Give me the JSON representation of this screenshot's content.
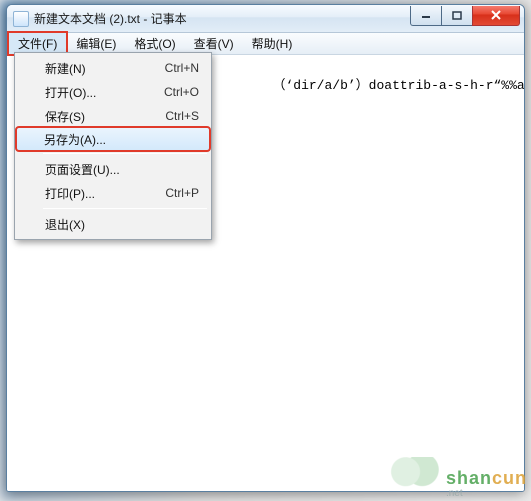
{
  "window": {
    "title": "新建文本文档 (2).txt - 记事本"
  },
  "menubar": {
    "file": "文件(F)",
    "edit": "编辑(E)",
    "format": "格式(O)",
    "view": "查看(V)",
    "help": "帮助(H)"
  },
  "file_menu": {
    "new": {
      "label": "新建(N)",
      "shortcut": "Ctrl+N"
    },
    "open": {
      "label": "打开(O)...",
      "shortcut": "Ctrl+O"
    },
    "save": {
      "label": "保存(S)",
      "shortcut": "Ctrl+S"
    },
    "save_as": {
      "label": "另存为(A)...",
      "shortcut": ""
    },
    "page_setup": {
      "label": "页面设置(U)...",
      "shortcut": ""
    },
    "print": {
      "label": "打印(P)...",
      "shortcut": "Ctrl+P"
    },
    "exit": {
      "label": "退出(X)",
      "shortcut": ""
    }
  },
  "editor": {
    "content": "（‘dir/a/b’）doattrib-a-s-h-r“%%a"
  },
  "watermark": {
    "brand_green": "shan",
    "brand_orange": "cun",
    "sub": ".net"
  }
}
